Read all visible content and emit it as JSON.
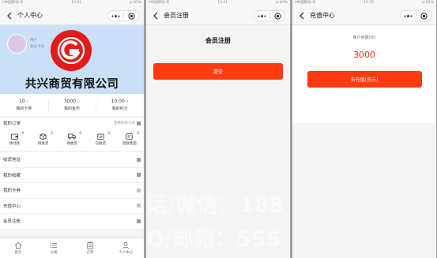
{
  "status_bar": {
    "phone1": {
      "left": "Il中国移动 令",
      "center": "13:41",
      "right": "◎ 83%"
    },
    "phone2": {
      "left": "Il中国移动 令",
      "center": "13:41",
      "right": "◎ 83%"
    },
    "phone3": {
      "left": "Il中国移动 令",
      "center": "10:35",
      "right": "◎ 82%"
    }
  },
  "profile": {
    "nav_title": "个人中心",
    "user_lines": [
      "用户",
      "会员卡号"
    ],
    "company": "共兴商贸有限公司",
    "stats": [
      {
        "value": "10",
        "unit": "个",
        "label": "我的卡券"
      },
      {
        "value": "3000",
        "unit": "元",
        "label": "我的金币"
      },
      {
        "value": "10.00",
        "unit": "分",
        "label": "我的积分"
      }
    ],
    "orders": {
      "title": "我的订单",
      "view_all": "查看所有订单",
      "items": [
        {
          "label": "待付款",
          "count": "0"
        },
        {
          "label": "待发货",
          "count": "0"
        },
        {
          "label": "待收货",
          "count": "0"
        },
        {
          "label": "已收货",
          "count": "0"
        },
        {
          "label": "退款售后",
          "count": "0"
        }
      ]
    },
    "menu": [
      "收货地址",
      "我的收藏",
      "我的卡券",
      "充值中心",
      "会员注册"
    ],
    "tabs": [
      {
        "label": "首页",
        "icon": "home-icon"
      },
      {
        "label": "分类",
        "icon": "list-icon"
      },
      {
        "label": "订单",
        "icon": "clipboard-icon"
      },
      {
        "label": "个人中心",
        "icon": "user-icon"
      }
    ]
  },
  "register": {
    "nav_title": "会员注册",
    "heading": "会员注册",
    "submit_label": "提交"
  },
  "recharge": {
    "nav_title": "充值中心",
    "balance_label": "账户余额(元)",
    "balance_value": "3000",
    "button_label": "去充值(充元)"
  },
  "watermark": {
    "line1": "话/微信：188",
    "line2": "Q/邮箱：555"
  },
  "colors": {
    "accent": "#ff3c10",
    "balance": "#e8331d",
    "logo_red": "#e41b1b",
    "banner": "#c9e0f6"
  }
}
